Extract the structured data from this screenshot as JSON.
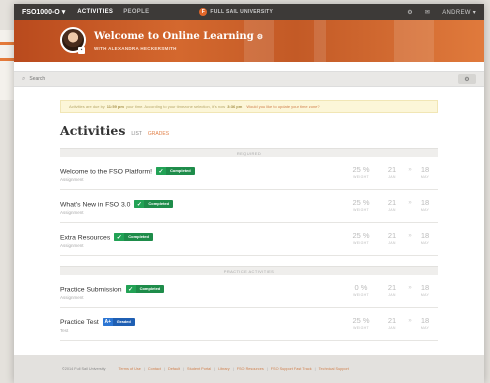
{
  "nav": {
    "course": "FSO1000-O",
    "course_caret": "▾",
    "links": [
      "ACTIVITIES",
      "PEOPLE"
    ],
    "brand": "FULL SAIL UNIVERSITY",
    "user": "ANDREW",
    "user_caret": "▾"
  },
  "hero": {
    "welcome": "Welcome to Online Learning",
    "subtitle": "WITH ALEXANDRA HECKERSMITH"
  },
  "search": {
    "placeholder": "Search"
  },
  "alert": {
    "prefix": "Activities are due by",
    "time1": "11:59 pm",
    "middle": "your time. According to your timezone selection, it's now",
    "time2": "3:36 pm",
    "link": "Would you like to update your time zone?"
  },
  "activities": {
    "heading": "Activities",
    "tabs": [
      "LIST",
      "GRADES"
    ],
    "sections": [
      {
        "label": "REQUIRED",
        "items": [
          {
            "title": "Welcome to the FSO Platform!",
            "type": "Assignment",
            "badge": "Completed",
            "badge_kind": "completed",
            "pct": "25 %",
            "pct_label": "WEIGHT",
            "due": "21",
            "due_label": "JAN",
            "end": "18",
            "end_label": "MAY"
          },
          {
            "title": "What's New in FSO 3.0",
            "type": "Assignment",
            "badge": "Completed",
            "badge_kind": "completed",
            "pct": "25 %",
            "pct_label": "WEIGHT",
            "due": "21",
            "due_label": "JAN",
            "end": "18",
            "end_label": "MAY"
          },
          {
            "title": "Extra Resources",
            "type": "Assignment",
            "badge": "Completed",
            "badge_kind": "completed",
            "pct": "25 %",
            "pct_label": "WEIGHT",
            "due": "21",
            "due_label": "JAN",
            "end": "18",
            "end_label": "MAY"
          }
        ]
      },
      {
        "label": "PRACTICE ACTIVITIES",
        "items": [
          {
            "title": "Practice Submission",
            "type": "Assignment",
            "badge": "Completed",
            "badge_kind": "completed",
            "pct": "0 %",
            "pct_label": "WEIGHT",
            "due": "21",
            "due_label": "JAN",
            "end": "18",
            "end_label": "MAY"
          },
          {
            "title": "Practice Test",
            "type": "Test",
            "badge": "Graded",
            "badge_grade": "A+",
            "badge_kind": "graded",
            "pct": "25 %",
            "pct_label": "WEIGHT",
            "due": "21",
            "due_label": "JAN",
            "end": "18",
            "end_label": "MAY"
          }
        ]
      }
    ]
  },
  "footer": {
    "copyright": "©2014 Full Sail University",
    "links": [
      "Terms of Use",
      "Contact",
      "Default",
      "Student Portal",
      "Library",
      "FSO Resources",
      "FSO Support Fast Track",
      "Technical Support"
    ]
  },
  "colors": {
    "accent": "#e2672a",
    "completed": "#1e8c4a",
    "graded": "#1f5fb3",
    "nav": "#3d3a38"
  },
  "icons": {
    "search": "search-icon",
    "gear": "gear-icon",
    "check": "check-icon",
    "bell": "bell-icon",
    "mail": "mail-icon",
    "settings": "settings-icon"
  }
}
